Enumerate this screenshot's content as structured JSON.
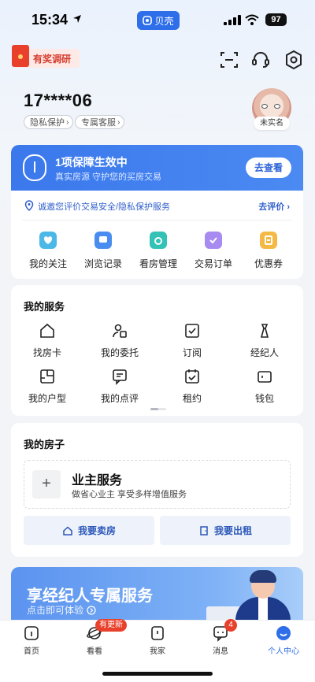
{
  "status_bar": {
    "time": "15:34",
    "app_pill": "贝壳",
    "battery": "97"
  },
  "header": {
    "survey_badge": "有奖调研"
  },
  "profile": {
    "phone": "17****06",
    "tags": [
      "隐私保护",
      "专属客服"
    ],
    "avatar_label": "未实名"
  },
  "guarantee": {
    "title": "1项保障生效中",
    "subtitle": "真实房源 守护您的买房交易",
    "button": "去查看"
  },
  "evaluation": {
    "text": "诚邀您评价交易安全/隐私保护服务",
    "link": "去评价"
  },
  "quick_items": [
    {
      "label": "我的关注",
      "icon": "heart-icon",
      "color": "#4bb8e8"
    },
    {
      "label": "浏览记录",
      "icon": "chat-icon",
      "color": "#4a8df0"
    },
    {
      "label": "看房管理",
      "icon": "camera-icon",
      "color": "#33c2b5"
    },
    {
      "label": "交易订单",
      "icon": "order-check-icon",
      "color": "#a78bf0"
    },
    {
      "label": "优惠券",
      "icon": "coupon-icon",
      "color": "#f4b944"
    }
  ],
  "services": {
    "title": "我的服务",
    "items": [
      {
        "label": "找房卡",
        "icon": "house-card-icon"
      },
      {
        "label": "我的委托",
        "icon": "entrust-icon"
      },
      {
        "label": "订阅",
        "icon": "subscribe-icon"
      },
      {
        "label": "经纪人",
        "icon": "agent-icon"
      },
      {
        "label": "我的户型",
        "icon": "floorplan-icon"
      },
      {
        "label": "我的点评",
        "icon": "comment-icon"
      },
      {
        "label": "租约",
        "icon": "lease-icon"
      },
      {
        "label": "钱包",
        "icon": "wallet-icon"
      }
    ]
  },
  "house": {
    "title": "我的房子",
    "owner_title": "业主服务",
    "owner_sub": "做省心业主 享受多样增值服务",
    "sell": "我要卖房",
    "rent": "我要出租"
  },
  "promo": {
    "title": "享经纪人专属服务",
    "sub": "点击即可体验"
  },
  "tabbar": {
    "tabs": [
      {
        "label": "首页",
        "icon": "home-icon"
      },
      {
        "label": "看看",
        "icon": "planet-icon"
      },
      {
        "label": "我家",
        "icon": "my-home-icon"
      },
      {
        "label": "消息",
        "icon": "message-icon"
      },
      {
        "label": "个人中心",
        "icon": "profile-icon"
      }
    ],
    "new_badge": "有更新",
    "message_count": "4"
  },
  "colors": {
    "primary": "#2f6ee9",
    "alert": "#e8402b"
  }
}
